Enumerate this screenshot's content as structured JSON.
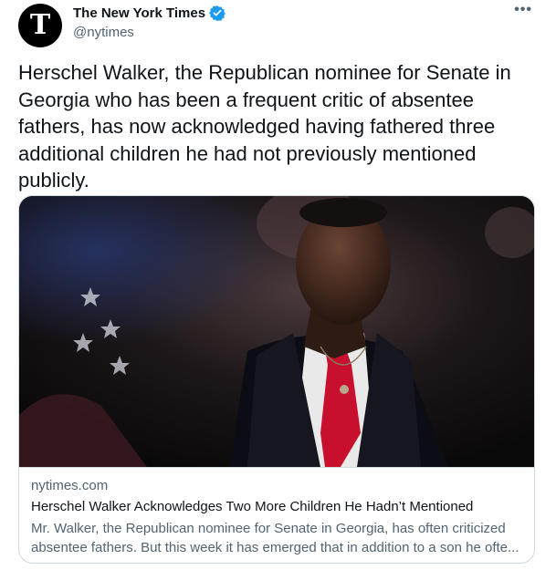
{
  "author": {
    "display_name": "The New York Times",
    "handle": "@nytimes",
    "avatar_glyph": "T",
    "verified_color": "#1d9bf0"
  },
  "more_label": "•••",
  "tweet": {
    "text": "Herschel Walker, the Republican nominee for Senate in Georgia who has been a frequent critic of absentee fathers, has now acknowledged having fathered three additional children he had not previously mentioned publicly."
  },
  "card": {
    "domain": "nytimes.com",
    "title": "Herschel Walker Acknowledges Two More Children He Hadn’t Mentioned",
    "description_line1": "Mr. Walker, the Republican nominee for Senate in Georgia, has often criticized",
    "description_line2": "absentee fathers. But this week it has emerged that in addition to a son he ofte..."
  },
  "colors": {
    "text_primary": "#0f1419",
    "text_secondary": "#536471",
    "border": "#cfd9de",
    "tie_red": "#c8102e"
  }
}
